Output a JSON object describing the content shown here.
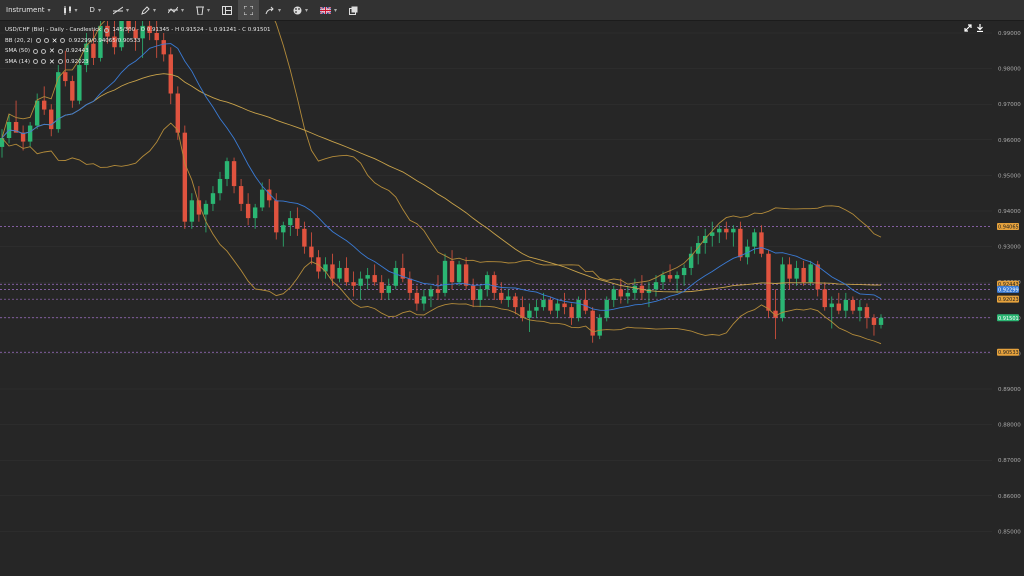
{
  "toolbar": {
    "instrument_label": "Instrument",
    "timeframe_label": "D",
    "items": [
      {
        "name": "draw-line-tool",
        "icon": "line-tool-icon"
      },
      {
        "name": "pencil-tool",
        "icon": "pencil-icon"
      },
      {
        "name": "indicators-tool",
        "icon": "indicators-icon"
      },
      {
        "name": "delete-tool",
        "icon": "trash-icon"
      },
      {
        "name": "layout-tool",
        "icon": "layout-icon"
      },
      {
        "name": "fullscreen-tool",
        "icon": "crosshair-icon"
      },
      {
        "name": "share-tool",
        "icon": "share-arrow-icon"
      },
      {
        "name": "theme-tool",
        "icon": "palette-icon"
      },
      {
        "name": "language-tool",
        "icon": "uk-flag-icon"
      },
      {
        "name": "window-tool",
        "icon": "popout-icon"
      }
    ]
  },
  "legend": {
    "symbol": "USD/CHF (Bid) - Daily - Candlestick",
    "ohlc": "145/300 - O 0.91345 - H 0.91524 - L 0.91241 - C 0.91501",
    "bb_label": "BB (20, 2)",
    "bb_values": "0.92299/0.94065/0.90533",
    "sma50_label": "SMA (50)",
    "sma50_value": "0.92443",
    "sma14_label": "SMA (14)",
    "sma14_value": "0.92023"
  },
  "chart_data": {
    "type": "candlestick",
    "y_range": [
      0.845,
      0.905
    ],
    "y_ticks": [
      0.995,
      0.985,
      0.975,
      0.965,
      0.955,
      0.945,
      0.935,
      0.925,
      0.915,
      0.905,
      0.895,
      0.885,
      0.875,
      0.865,
      0.855
    ],
    "y_tick_labels": [
      "0.99000",
      "0.98000",
      "0.97000",
      "0.96000",
      "0.95000",
      "0.94000",
      "0.93000",
      "0.92000",
      "0.91000",
      "0.90000",
      "0.89000",
      "0.88000",
      "0.87000",
      "0.86000",
      "0.85000"
    ],
    "price_tags": [
      {
        "label": "0.94065",
        "value": 0.94065,
        "color": "#e6a23c"
      },
      {
        "label": "0.92443",
        "value": 0.92443,
        "color": "#e6a23c"
      },
      {
        "label": "0.92299",
        "value": 0.92299,
        "color": "#3a7bd5"
      },
      {
        "label": "0.92023",
        "value": 0.92023,
        "color": "#e6a23c"
      },
      {
        "label": "0.91501",
        "value": 0.91501,
        "color": "#2bb673"
      },
      {
        "label": "0.90533",
        "value": 0.90533,
        "color": "#e6a23c"
      }
    ],
    "candles": [
      [
        0.963,
        0.968,
        0.96,
        0.9655
      ],
      [
        0.9655,
        0.972,
        0.964,
        0.97
      ],
      [
        0.97,
        0.976,
        0.968,
        0.967
      ],
      [
        0.967,
        0.969,
        0.962,
        0.9645
      ],
      [
        0.9645,
        0.97,
        0.963,
        0.969
      ],
      [
        0.969,
        0.978,
        0.968,
        0.976
      ],
      [
        0.976,
        0.98,
        0.972,
        0.9735
      ],
      [
        0.9735,
        0.975,
        0.966,
        0.968
      ],
      [
        0.968,
        0.986,
        0.967,
        0.984
      ],
      [
        0.984,
        0.99,
        0.98,
        0.9815
      ],
      [
        0.9815,
        0.983,
        0.974,
        0.976
      ],
      [
        0.976,
        0.988,
        0.975,
        0.986
      ],
      [
        0.986,
        0.995,
        0.984,
        0.992
      ],
      [
        0.992,
        0.996,
        0.986,
        0.988
      ],
      [
        0.988,
        0.999,
        0.987,
        0.997
      ],
      [
        0.997,
        1.0,
        0.992,
        0.994
      ],
      [
        0.994,
        1.0,
        0.989,
        0.991
      ],
      [
        0.991,
        1.0,
        0.99,
        0.999
      ],
      [
        0.999,
        1.0,
        0.995,
        0.996
      ],
      [
        0.996,
        1.0,
        0.99,
        0.9935
      ],
      [
        0.9935,
        0.999,
        0.988,
        0.997
      ],
      [
        0.997,
        1.0,
        0.993,
        0.995
      ],
      [
        0.995,
        0.999,
        0.988,
        0.993
      ],
      [
        0.993,
        0.995,
        0.987,
        0.989
      ],
      [
        0.989,
        0.991,
        0.975,
        0.978
      ],
      [
        0.978,
        0.98,
        0.965,
        0.967
      ],
      [
        0.967,
        0.969,
        0.94,
        0.942
      ],
      [
        0.942,
        0.95,
        0.94,
        0.948
      ],
      [
        0.948,
        0.952,
        0.942,
        0.944
      ],
      [
        0.944,
        0.948,
        0.939,
        0.947
      ],
      [
        0.947,
        0.952,
        0.945,
        0.95
      ],
      [
        0.95,
        0.956,
        0.948,
        0.954
      ],
      [
        0.954,
        0.96,
        0.952,
        0.959
      ],
      [
        0.959,
        0.96,
        0.95,
        0.952
      ],
      [
        0.952,
        0.954,
        0.945,
        0.947
      ],
      [
        0.947,
        0.95,
        0.941,
        0.943
      ],
      [
        0.943,
        0.947,
        0.94,
        0.946
      ],
      [
        0.946,
        0.953,
        0.945,
        0.951
      ],
      [
        0.951,
        0.954,
        0.946,
        0.948
      ],
      [
        0.948,
        0.95,
        0.937,
        0.939
      ],
      [
        0.939,
        0.942,
        0.935,
        0.941
      ],
      [
        0.941,
        0.945,
        0.938,
        0.943
      ],
      [
        0.943,
        0.946,
        0.938,
        0.94
      ],
      [
        0.94,
        0.942,
        0.933,
        0.935
      ],
      [
        0.935,
        0.939,
        0.93,
        0.932
      ],
      [
        0.932,
        0.934,
        0.926,
        0.928
      ],
      [
        0.928,
        0.932,
        0.926,
        0.93
      ],
      [
        0.93,
        0.933,
        0.924,
        0.926
      ],
      [
        0.926,
        0.931,
        0.925,
        0.929
      ],
      [
        0.929,
        0.932,
        0.924,
        0.925
      ],
      [
        0.925,
        0.928,
        0.921,
        0.924
      ],
      [
        0.924,
        0.928,
        0.92,
        0.926
      ],
      [
        0.926,
        0.929,
        0.923,
        0.927
      ],
      [
        0.927,
        0.93,
        0.924,
        0.925
      ],
      [
        0.925,
        0.927,
        0.92,
        0.922
      ],
      [
        0.922,
        0.926,
        0.92,
        0.924
      ],
      [
        0.924,
        0.931,
        0.923,
        0.929
      ],
      [
        0.929,
        0.933,
        0.925,
        0.926
      ],
      [
        0.926,
        0.928,
        0.92,
        0.922
      ],
      [
        0.922,
        0.924,
        0.917,
        0.919
      ],
      [
        0.919,
        0.923,
        0.917,
        0.921
      ],
      [
        0.921,
        0.924,
        0.918,
        0.923
      ],
      [
        0.923,
        0.927,
        0.92,
        0.922
      ],
      [
        0.922,
        0.933,
        0.921,
        0.931
      ],
      [
        0.931,
        0.934,
        0.923,
        0.925
      ],
      [
        0.925,
        0.931,
        0.924,
        0.93
      ],
      [
        0.93,
        0.932,
        0.923,
        0.924
      ],
      [
        0.924,
        0.926,
        0.918,
        0.92
      ],
      [
        0.92,
        0.924,
        0.918,
        0.923
      ],
      [
        0.923,
        0.928,
        0.921,
        0.927
      ],
      [
        0.927,
        0.928,
        0.92,
        0.922
      ],
      [
        0.922,
        0.925,
        0.919,
        0.92
      ],
      [
        0.92,
        0.923,
        0.918,
        0.921
      ],
      [
        0.921,
        0.922,
        0.916,
        0.918
      ],
      [
        0.918,
        0.921,
        0.914,
        0.915
      ],
      [
        0.915,
        0.919,
        0.911,
        0.917
      ],
      [
        0.917,
        0.92,
        0.915,
        0.918
      ],
      [
        0.918,
        0.922,
        0.917,
        0.92
      ],
      [
        0.92,
        0.921,
        0.916,
        0.917
      ],
      [
        0.917,
        0.92,
        0.915,
        0.919
      ],
      [
        0.919,
        0.922,
        0.916,
        0.918
      ],
      [
        0.918,
        0.919,
        0.913,
        0.915
      ],
      [
        0.915,
        0.921,
        0.914,
        0.92
      ],
      [
        0.92,
        0.923,
        0.916,
        0.917
      ],
      [
        0.917,
        0.918,
        0.908,
        0.91
      ],
      [
        0.91,
        0.916,
        0.909,
        0.915
      ],
      [
        0.915,
        0.921,
        0.914,
        0.92
      ],
      [
        0.92,
        0.924,
        0.918,
        0.923
      ],
      [
        0.923,
        0.926,
        0.919,
        0.921
      ],
      [
        0.921,
        0.924,
        0.919,
        0.922
      ],
      [
        0.922,
        0.926,
        0.92,
        0.924
      ],
      [
        0.924,
        0.927,
        0.92,
        0.922
      ],
      [
        0.922,
        0.925,
        0.918,
        0.923
      ],
      [
        0.923,
        0.927,
        0.921,
        0.925
      ],
      [
        0.925,
        0.928,
        0.923,
        0.927
      ],
      [
        0.927,
        0.93,
        0.925,
        0.926
      ],
      [
        0.926,
        0.928,
        0.922,
        0.927
      ],
      [
        0.927,
        0.93,
        0.924,
        0.929
      ],
      [
        0.929,
        0.935,
        0.927,
        0.933
      ],
      [
        0.933,
        0.938,
        0.93,
        0.936
      ],
      [
        0.936,
        0.94,
        0.933,
        0.938
      ],
      [
        0.938,
        0.942,
        0.935,
        0.939
      ],
      [
        0.939,
        0.941,
        0.936,
        0.94
      ],
      [
        0.94,
        0.942,
        0.937,
        0.939
      ],
      [
        0.939,
        0.941,
        0.935,
        0.94
      ],
      [
        0.94,
        0.942,
        0.931,
        0.932
      ],
      [
        0.932,
        0.937,
        0.93,
        0.935
      ],
      [
        0.935,
        0.94,
        0.933,
        0.939
      ],
      [
        0.939,
        0.941,
        0.932,
        0.933
      ],
      [
        0.933,
        0.934,
        0.915,
        0.917
      ],
      [
        0.917,
        0.923,
        0.909,
        0.915
      ],
      [
        0.915,
        0.932,
        0.914,
        0.93
      ],
      [
        0.93,
        0.932,
        0.923,
        0.926
      ],
      [
        0.926,
        0.931,
        0.924,
        0.929
      ],
      [
        0.929,
        0.931,
        0.924,
        0.925
      ],
      [
        0.925,
        0.931,
        0.924,
        0.93
      ],
      [
        0.93,
        0.931,
        0.921,
        0.923
      ],
      [
        0.923,
        0.925,
        0.917,
        0.918
      ],
      [
        0.918,
        0.921,
        0.912,
        0.919
      ],
      [
        0.919,
        0.922,
        0.916,
        0.917
      ],
      [
        0.917,
        0.922,
        0.915,
        0.92
      ],
      [
        0.92,
        0.921,
        0.916,
        0.917
      ],
      [
        0.917,
        0.92,
        0.914,
        0.918
      ],
      [
        0.918,
        0.919,
        0.912,
        0.915
      ],
      [
        0.915,
        0.916,
        0.91,
        0.913
      ],
      [
        0.913,
        0.916,
        0.912,
        0.915
      ]
    ]
  },
  "colors": {
    "background": "#262626",
    "grid": "#333333",
    "up": "#2bb673",
    "down": "#e0533f",
    "bollinger": "#b38b3a",
    "sma50": "#c8a24a",
    "sma14": "#3a7bd5",
    "hline": "#a070c8"
  }
}
